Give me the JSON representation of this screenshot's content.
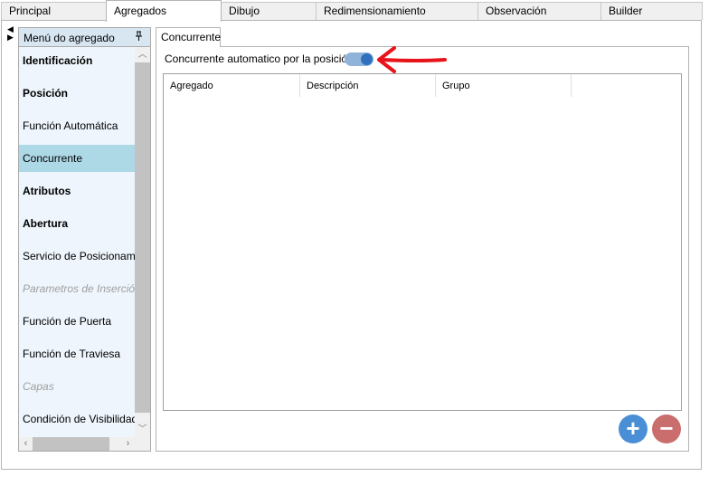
{
  "top_tabs": [
    {
      "label": "Principal"
    },
    {
      "label": "Agregados"
    },
    {
      "label": "Dibujo"
    },
    {
      "label": "Redimensionamiento"
    },
    {
      "label": "Observación"
    },
    {
      "label": "Builder"
    }
  ],
  "active_top_tab": "Agregados",
  "side_panel": {
    "title": "Menú do agregado",
    "pin_icon": "pin-icon",
    "items": [
      {
        "label": "Identificación",
        "style": "bold"
      },
      {
        "label": "Posición",
        "style": "bold"
      },
      {
        "label": "Función Automática",
        "style": "normal"
      },
      {
        "label": "Concurrente",
        "style": "selected"
      },
      {
        "label": "Atributos",
        "style": "bold"
      },
      {
        "label": "Abertura",
        "style": "bold"
      },
      {
        "label": "Servicio de Posicionamiento",
        "style": "normal"
      },
      {
        "label": "Parametros de Inserción",
        "style": "disabled"
      },
      {
        "label": "Función de Puerta",
        "style": "normal"
      },
      {
        "label": "Función de Traviesa",
        "style": "normal"
      },
      {
        "label": "Capas",
        "style": "disabled"
      },
      {
        "label": "Condición de Visibilidad",
        "style": "normal"
      }
    ]
  },
  "inner_tab": {
    "label": "Concurrente"
  },
  "auto_toggle": {
    "label": "Concurrente automatico por la posición",
    "on": true
  },
  "grid": {
    "columns": [
      "Agregado",
      "Descripción",
      "Grupo"
    ],
    "rows": []
  },
  "buttons": {
    "add_symbol": "+",
    "remove_symbol": "−"
  },
  "colors": {
    "selected_bg": "#add8e6",
    "add_btn": "#4a8fd6",
    "remove_btn": "#c96d6d",
    "toggle": "#2f71bd",
    "annotation_arrow": "#e8131b"
  }
}
